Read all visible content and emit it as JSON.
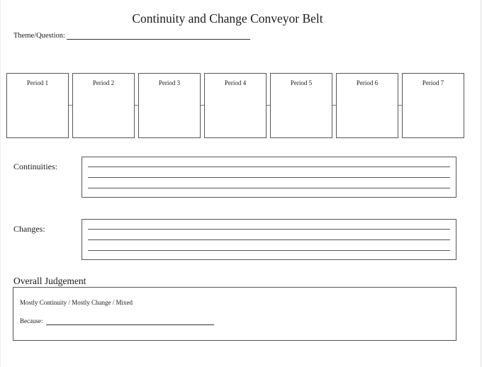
{
  "worksheet": {
    "title": "Continuity and Change Conveyor Belt",
    "theme_label": "Theme/Question:",
    "periods": [
      {
        "label": "Period 1"
      },
      {
        "label": "Period 2"
      },
      {
        "label": "Period 3"
      },
      {
        "label": "Period 4"
      },
      {
        "label": "Period 5"
      },
      {
        "label": "Period 6"
      },
      {
        "label": "Period 7"
      }
    ],
    "continuities": {
      "label": "Continuities:"
    },
    "changes": {
      "label": "Changes:"
    },
    "judgement": {
      "title": "Overall Judgement",
      "options": "Mostly Continuity / Mostly Change / Mixed",
      "because_label": "Because:"
    }
  }
}
